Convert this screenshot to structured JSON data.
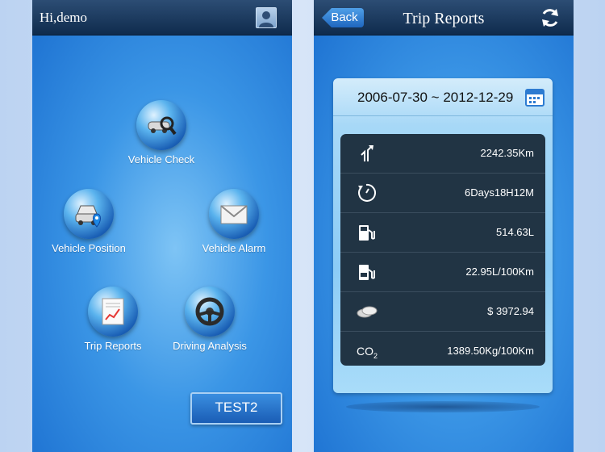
{
  "left_screen": {
    "greeting": "Hi,demo",
    "menu": [
      {
        "key": "vehicle_check",
        "label": "Vehicle Check",
        "icon": "car-magnifier-icon"
      },
      {
        "key": "vehicle_position",
        "label": "Vehicle Position",
        "icon": "car-pin-icon"
      },
      {
        "key": "vehicle_alarm",
        "label": "Vehicle Alarm",
        "icon": "envelope-icon"
      },
      {
        "key": "trip_reports",
        "label": "Trip Reports",
        "icon": "report-chart-icon"
      },
      {
        "key": "driving_analysis",
        "label": "Driving Analysis",
        "icon": "steering-wheel-icon"
      }
    ],
    "test_button": "TEST2"
  },
  "right_screen": {
    "back_label": "Back",
    "title": "Trip Reports",
    "date_range": "2006-07-30 ~ 2012-12-29",
    "stats": [
      {
        "icon": "route-icon",
        "value": "2242.35Km"
      },
      {
        "icon": "timer-icon",
        "value": "6Days18H12M"
      },
      {
        "icon": "fuel-pump-icon",
        "value": "514.63L"
      },
      {
        "icon": "fuel-100-icon",
        "value": "22.95L/100Km"
      },
      {
        "icon": "coins-icon",
        "value": "$ 3972.94"
      },
      {
        "icon": "co2-icon",
        "label": "CO",
        "label_sub": "2",
        "value": "1389.50Kg/100Km"
      }
    ]
  },
  "colors": {
    "navbar": "#0f2b4d",
    "screen_bg": "#3b96e6",
    "stats_bg": "#213444"
  }
}
